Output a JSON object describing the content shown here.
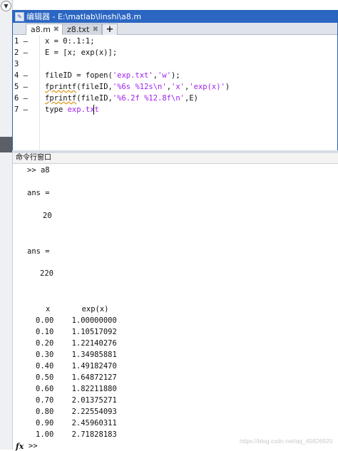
{
  "editor": {
    "title": "编辑器 - E:\\matlab\\linshi\\a8.m",
    "tabs": [
      {
        "label": "a8.m",
        "active": true
      },
      {
        "label": "z8.txt",
        "active": false
      }
    ],
    "add_tab": "+",
    "tab_close": "✖",
    "lines": [
      {
        "num": "1",
        "marker": "—"
      },
      {
        "num": "2",
        "marker": "—"
      },
      {
        "num": "3",
        "marker": ""
      },
      {
        "num": "4",
        "marker": "—"
      },
      {
        "num": "5",
        "marker": "—"
      },
      {
        "num": "6",
        "marker": "—"
      },
      {
        "num": "7",
        "marker": "—"
      }
    ],
    "code": {
      "l1": "x = 0:.1:1;",
      "l2": "E = [x; exp(x)];",
      "l4a": "fileID = fopen(",
      "l4s1": "'exp.txt'",
      "l4c": ",",
      "l4s2": "'w'",
      "l4e": ");",
      "l5f": "fprintf",
      "l5a": "(fileID,",
      "l5s1": "'%6s %12s\\n'",
      "l5c1": ",",
      "l5s2": "'x'",
      "l5c2": ",",
      "l5s3": "'exp(x)'",
      "l5e": ")",
      "l6f": "fprintf",
      "l6a": "(fileID,",
      "l6s1": "'%6.2f %12.8f\\n'",
      "l6e": ",E)",
      "l7a": "type ",
      "l7s": "exp.txt"
    }
  },
  "command_window": {
    "title": "命令行窗口",
    "prompt_cmd": ">> a8",
    "ans1_label": "ans =",
    "ans1_value": "20",
    "ans2_label": "ans =",
    "ans2_value": "220",
    "table_header": "x       exp(x)",
    "table_rows": [
      "0.00    1.00000000",
      "0.10    1.10517092",
      "0.20    1.22140276",
      "0.30    1.34985881",
      "0.40    1.49182470",
      "0.50    1.64872127",
      "0.60    1.82211880",
      "0.70    2.01375271",
      "0.80    2.22554093",
      "0.90    2.45960311",
      "1.00    2.71828183"
    ],
    "fx_label": "fx",
    "prompt": ">>",
    "watermark": "https://blog.csdn.net/qq_45626920"
  },
  "icons": {
    "collapse": "chevron-down-icon",
    "editor": "editor-icon"
  },
  "colors": {
    "title_bar": "#2b66c3",
    "string": "#a020f0"
  }
}
